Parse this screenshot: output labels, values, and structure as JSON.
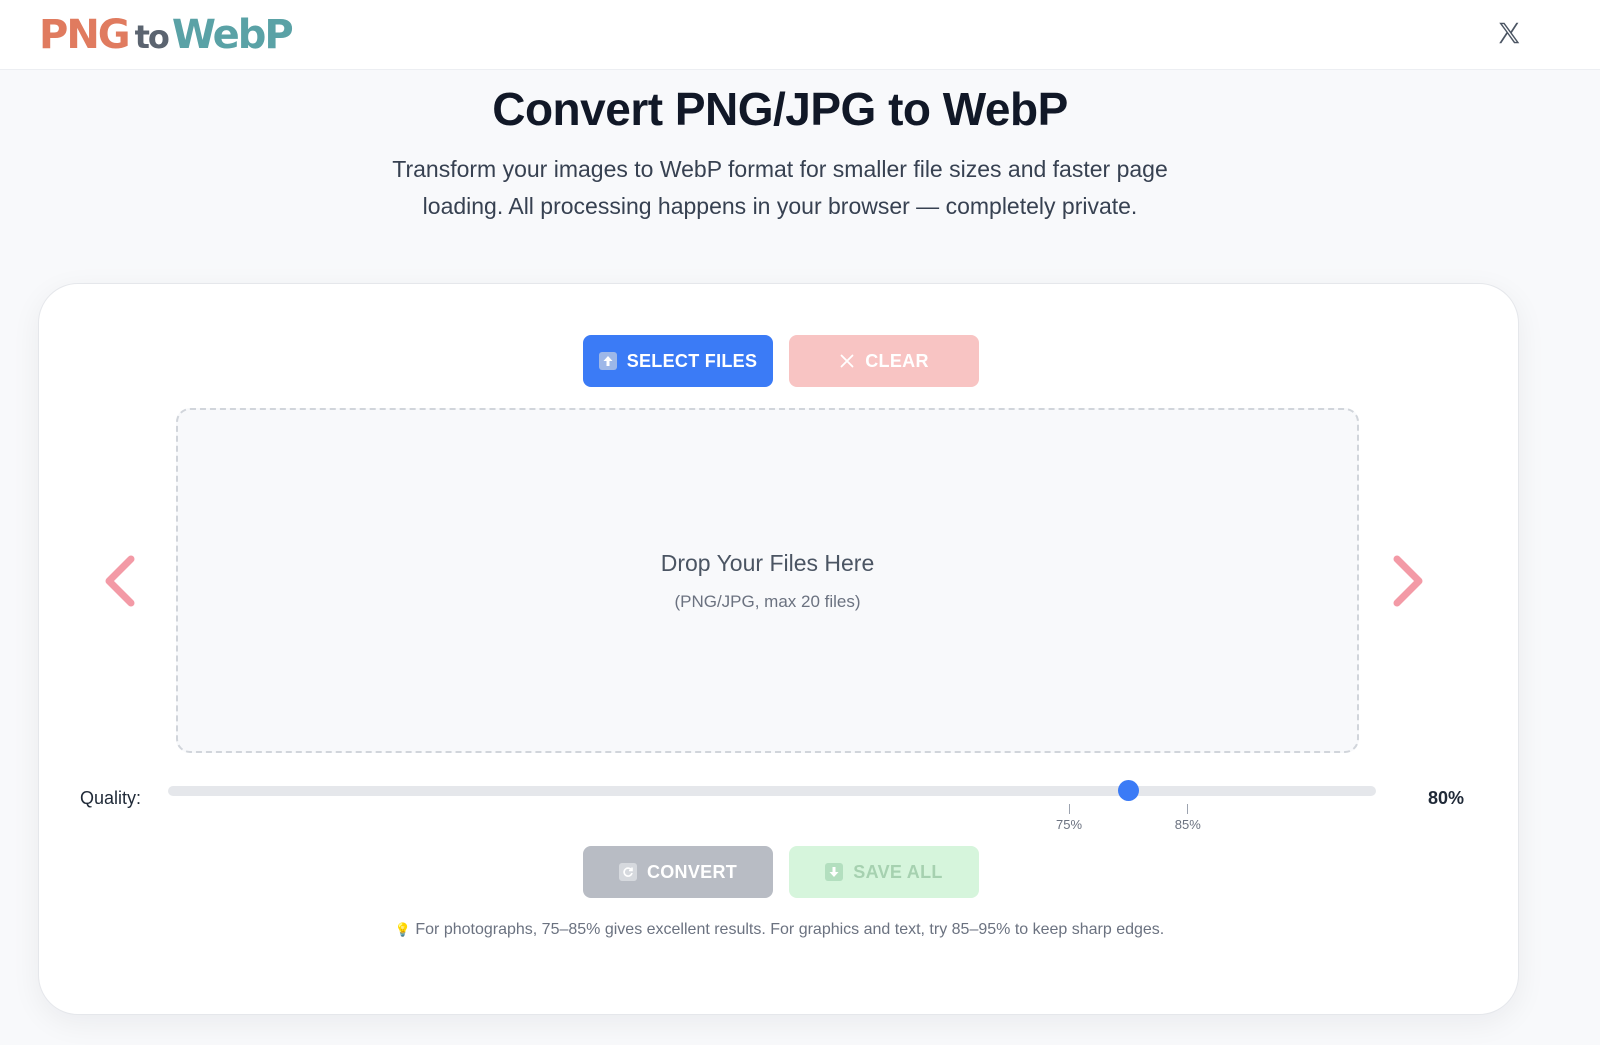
{
  "header": {
    "logo": {
      "part1": "PNG",
      "part2": "to",
      "part3": "WebP"
    },
    "social_icon": "x-logo-icon"
  },
  "hero": {
    "title": "Convert PNG/JPG to WebP",
    "subtitle": "Transform your images to WebP format for smaller file sizes and faster page loading. All processing happens in your browser — completely private."
  },
  "actions": {
    "select_label": "SELECT FILES",
    "clear_label": "CLEAR",
    "convert_label": "CONVERT",
    "save_all_label": "SAVE ALL"
  },
  "dropzone": {
    "title": "Drop Your Files Here",
    "hint": "(PNG/JPG, max 20 files)"
  },
  "quality": {
    "label": "Quality:",
    "value_text": "80%",
    "value": 80,
    "min": 0,
    "max": 100,
    "ticks": [
      {
        "value": 75,
        "label": "75%"
      },
      {
        "value": 85,
        "label": "85%"
      }
    ]
  },
  "tip": "For photographs, 75–85% gives excellent results. For graphics and text, try 85–95% to keep sharp edges.",
  "colors": {
    "primary": "#3b7bf6",
    "clear_disabled": "#f8c4c3",
    "convert_disabled": "#b8bcc4",
    "save_disabled": "#d6f5dc",
    "nav_arrow": "#f39aa6",
    "logo_png": "#e07b5f",
    "logo_webp": "#5aa2a6"
  }
}
